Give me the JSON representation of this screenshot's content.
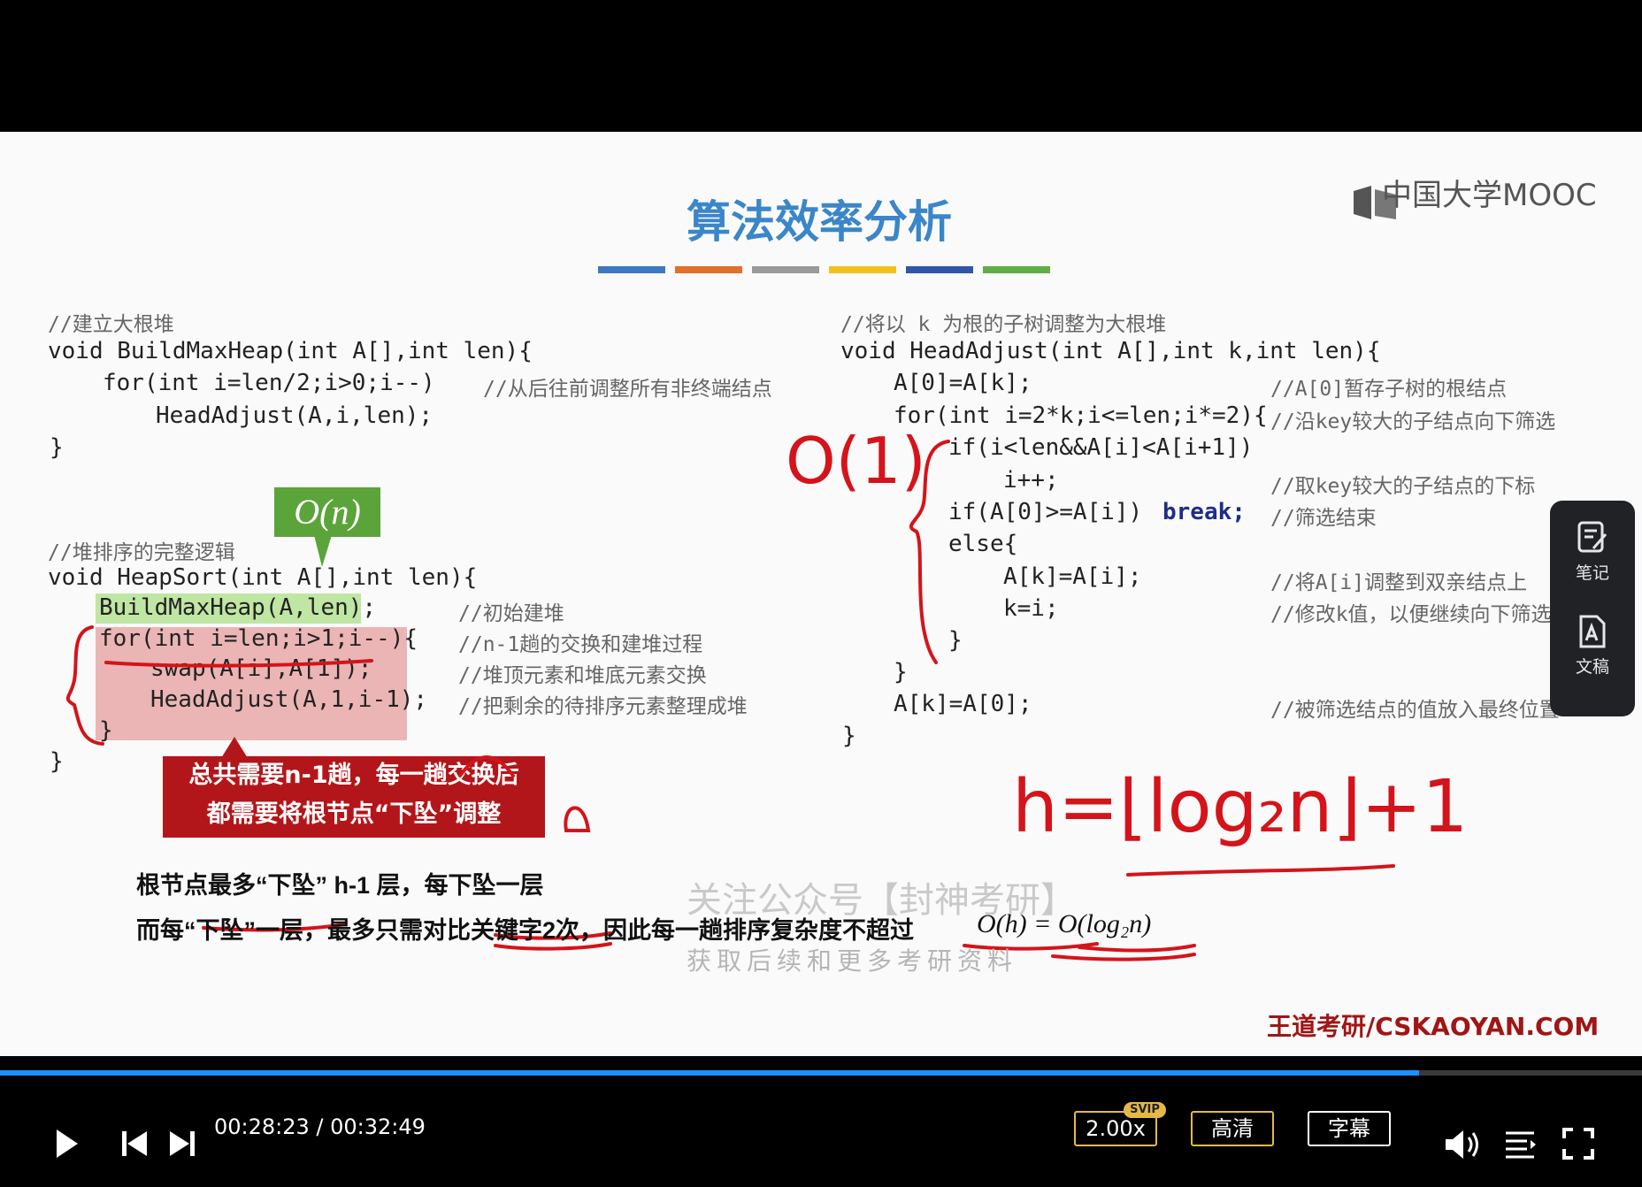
{
  "slide": {
    "title": "算法效率分析",
    "logo_text": "中国大学MOOC",
    "color_bars": [
      "#3d78c2",
      "#e0702a",
      "#9a9a9a",
      "#f2c11c",
      "#2f57a8",
      "#5fae44"
    ],
    "left": {
      "build_comment": "//建立大根堆",
      "build_l1": "void BuildMaxHeap(int A[],int len){",
      "build_l2": "for(int i=len/2;i>0;i--)",
      "build_l2_comment": "//从后往前调整所有非终端结点",
      "build_l3": "HeadAdjust(A,i,len);",
      "build_l4": "}",
      "sort_comment": "//堆排序的完整逻辑",
      "sort_l1": "void HeapSort(int A[],int len){",
      "sort_l2": "BuildMaxHeap(A,len);",
      "sort_l2_comment": "//初始建堆",
      "sort_l3": "for(int i=len;i>1;i--){",
      "sort_l3_comment": "//n-1趟的交换和建堆过程",
      "sort_l4": "swap(A[i],A[1]);",
      "sort_l4_comment": "//堆顶元素和堆底元素交换",
      "sort_l5": "HeadAdjust(A,1,i-1);",
      "sort_l5_comment": "//把剩余的待排序元素整理成堆",
      "sort_l6": "}",
      "sort_l7": "}"
    },
    "callout_on": "O(n)",
    "redbox_line1": "总共需要n-1趟，每一趟交换后",
    "redbox_line2": "都需要将根节点“下坠”调整",
    "right": {
      "comment": "//将以 k 为根的子树调整为大根堆",
      "l1": "void HeadAdjust(int A[],int k,int len){",
      "l2": "A[0]=A[k];",
      "l2_comment": "//A[0]暂存子树的根结点",
      "l3": "for(int i=2*k;i<=len;i*=2){",
      "l3_comment": "//沿key较大的子结点向下筛选",
      "l4": "if(i<len&&A[i]<A[i+1])",
      "l5": "i++;",
      "l5_comment": "//取key较大的子结点的下标",
      "l6": "if(A[0]>=A[i])",
      "l6_break": "break;",
      "l6_comment": "//筛选结束",
      "l7": "else{",
      "l8": "A[k]=A[i];",
      "l8_comment": "//将A[i]调整到双亲结点上",
      "l9": "k=i;",
      "l9_comment": "//修改k值，以便继续向下筛选",
      "l10": "}",
      "l11": "}",
      "l12": "A[k]=A[0];",
      "l12_comment": "//被筛选结点的值放入最终位置",
      "l13": "}"
    },
    "handwriting": {
      "o1": "O(1)",
      "h_formula": "h=⌊log₂n⌋+1"
    },
    "bottom_line1": "根节点最多“下坠” h-1 层，每下坠一层",
    "bottom_line2_text": "而每“下坠”一层，最多只需对比关键字2次，因此每一趟排序复杂度不超过",
    "bottom_line2_math": "O(h) = O(log₂n)",
    "watermark": "关注公众号【封神考研】",
    "watermark2": "获取后续和更多考研资料",
    "brand": "王道考研/CSKAOYAN.COM"
  },
  "side_panel": {
    "notes_label": "笔记",
    "doc_label": "文稿"
  },
  "player": {
    "current_time": "00:28:23",
    "separator": " / ",
    "total_time": "00:32:49",
    "progress": 0.864,
    "speed_label": "2.00x",
    "speed_badge": "SVIP",
    "quality_label": "高清",
    "subtitle_label": "字幕"
  }
}
